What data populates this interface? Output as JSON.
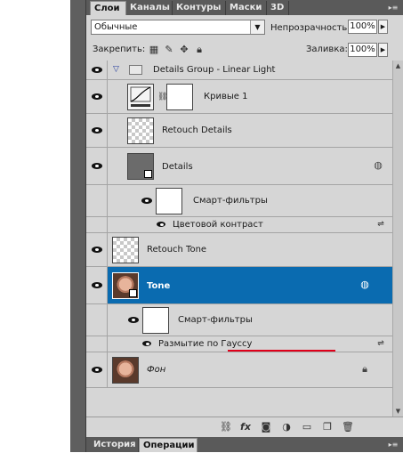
{
  "tabs": [
    {
      "label": "Слои",
      "active": true
    },
    {
      "label": "Каналы",
      "active": false
    },
    {
      "label": "Контуры",
      "active": false
    },
    {
      "label": "Маски",
      "active": false
    },
    {
      "label": "3D",
      "active": false
    }
  ],
  "options": {
    "blend_mode": "Обычные",
    "opacity_label": "Непрозрачность:",
    "opacity_value": "100%",
    "lock_label": "Закрепить:",
    "fill_label": "Заливка:",
    "fill_value": "100%"
  },
  "layers": [
    {
      "name": "Details Group - Linear Light",
      "type": "group",
      "visible": true,
      "expanded": true
    },
    {
      "name": "Кривые 1",
      "type": "adjustment-curves",
      "visible": true
    },
    {
      "name": "Retouch Details",
      "type": "pixel",
      "visible": true
    },
    {
      "name": "Details",
      "type": "smart-object",
      "visible": true
    },
    {
      "name": "Смарт-фильтры",
      "type": "smart-filters",
      "visible": true
    },
    {
      "name": "Цветовой контраст",
      "type": "filter",
      "visible": true
    },
    {
      "name": "Retouch Tone",
      "type": "pixel",
      "visible": true
    },
    {
      "name": "Tone",
      "type": "smart-object",
      "visible": true,
      "selected": true
    },
    {
      "name": "Смарт-фильтры",
      "type": "smart-filters",
      "visible": true
    },
    {
      "name": "Размытие по Гауссу",
      "type": "filter",
      "visible": true,
      "highlighted": true
    },
    {
      "name": "Фон",
      "type": "background",
      "visible": true,
      "locked": true
    }
  ],
  "bottom_tabs": [
    {
      "label": "История",
      "active": false
    },
    {
      "label": "Операции",
      "active": true
    }
  ],
  "colors": {
    "selection": "#0a6bb0",
    "panel_bg": "#d6d6d6",
    "tab_bar": "#5a5a5a",
    "highlight_underline": "#e0001a"
  }
}
